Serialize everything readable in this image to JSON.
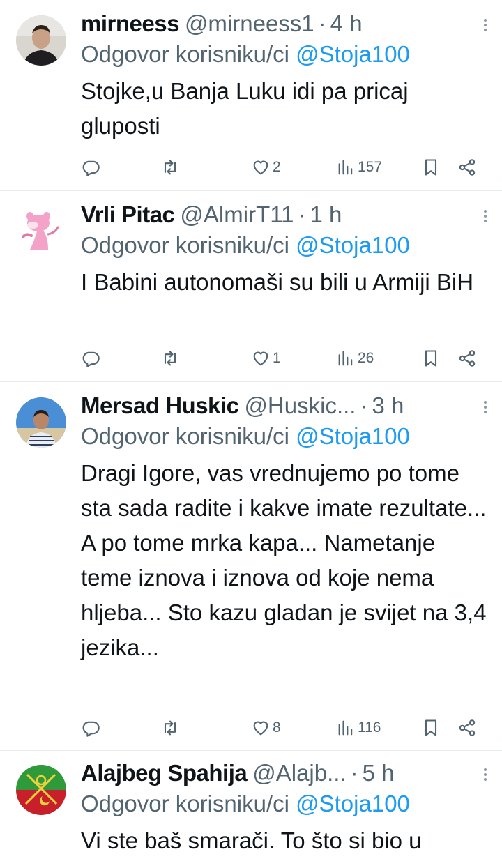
{
  "tweets": [
    {
      "name": "mirneess",
      "handle": "@mirneess1",
      "separator": "·",
      "time": "4 h",
      "reply_prefix": "Odgovor korisniku/ci",
      "reply_to": "@Stoja100",
      "text": "Stojke,u Banja Luku idi pa pricaj gluposti",
      "likes": "2",
      "views": "157",
      "avatar": "person-photo"
    },
    {
      "name": "Vrli Pitac",
      "handle": "@AlmirT11",
      "separator": "·",
      "time": "1 h",
      "reply_prefix": "Odgovor korisniku/ci",
      "reply_to": "@Stoja100",
      "text": "I Babini autonomaši su bili u Armiji BiH",
      "likes": "1",
      "views": "26",
      "avatar": "pink-panther"
    },
    {
      "name": "Mersad Huskic",
      "handle": "@Huskic...",
      "separator": "·",
      "time": "3 h",
      "reply_prefix": "Odgovor korisniku/ci",
      "reply_to": "@Stoja100",
      "text": "Dragi Igore, vas vrednujemo po tome sta sada radite i kakve imate rezultate... A po tome mrka kapa... Nametanje teme iznova i iznova od koje nema hljeba... Sto kazu gladan je svijet na 3,4 jezika...",
      "likes": "8",
      "views": "116",
      "avatar": "person-photo"
    },
    {
      "name": "Alajbeg Spahija",
      "handle": "@Alajb...",
      "separator": "·",
      "time": "5 h",
      "reply_prefix": "Odgovor korisniku/ci",
      "reply_to": "@Stoja100",
      "text": "Vi ste baš smarači. To što si bio u",
      "avatar": "flag-emblem"
    }
  ],
  "icons": {
    "reply": "reply-icon",
    "retweet": "retweet-icon",
    "like": "heart-icon",
    "views": "views-icon",
    "bookmark": "bookmark-icon",
    "share": "share-icon",
    "more": "more-icon"
  },
  "colors": {
    "accent": "#1d9bf0",
    "secondary_text": "#536471",
    "text": "#0f1419",
    "divider": "#e6ecf0"
  }
}
